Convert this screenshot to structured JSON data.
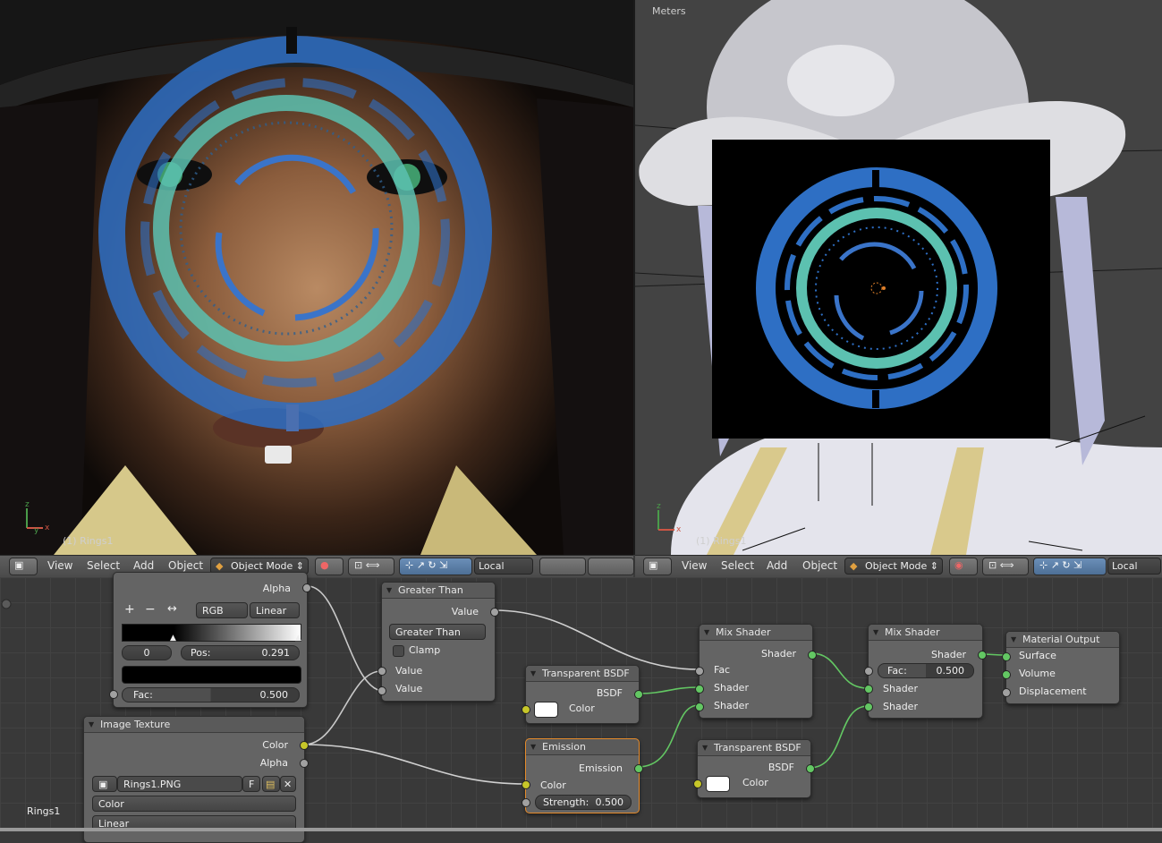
{
  "viewport_left": {
    "object_label": "(1) Rings1"
  },
  "viewport_right": {
    "units_label": "Meters",
    "object_label": "(1) Rings1"
  },
  "header_left": {
    "menus": [
      "View",
      "Select",
      "Add",
      "Object"
    ],
    "mode": "Object Mode",
    "orientation": "Local"
  },
  "header_right": {
    "menus": [
      "View",
      "Select",
      "Add",
      "Object"
    ],
    "mode": "Object Mode",
    "orientation": "Local"
  },
  "nodes": {
    "color_ramp": {
      "alpha_label": "Alpha",
      "color_mode": "RGB",
      "interpolation": "Linear",
      "stop_index": "0",
      "pos_label": "Pos:",
      "pos_value": "0.291",
      "fac_label": "Fac:",
      "fac_value": "0.500"
    },
    "image_texture": {
      "title": "Image Texture",
      "out_color": "Color",
      "out_alpha": "Alpha",
      "image_name": "Rings1.PNG",
      "fake_user": "F",
      "colorspace": "Color",
      "interpolation": "Linear"
    },
    "greater_than": {
      "title": "Greater Than",
      "out_value": "Value",
      "operation": "Greater Than",
      "clamp": "Clamp",
      "in_value1": "Value",
      "in_value2": "Value"
    },
    "transparent_bsdf_1": {
      "title": "Transparent BSDF",
      "out_bsdf": "BSDF",
      "in_color": "Color"
    },
    "emission": {
      "title": "Emission",
      "out_emission": "Emission",
      "in_color": "Color",
      "strength_label": "Strength:",
      "strength_value": "0.500"
    },
    "mix_shader_1": {
      "title": "Mix Shader",
      "out_shader": "Shader",
      "in_fac": "Fac",
      "in_shader1": "Shader",
      "in_shader2": "Shader"
    },
    "transparent_bsdf_2": {
      "title": "Transparent BSDF",
      "out_bsdf": "BSDF",
      "in_color": "Color"
    },
    "mix_shader_2": {
      "title": "Mix Shader",
      "out_shader": "Shader",
      "fac_label": "Fac:",
      "fac_value": "0.500",
      "in_shader1": "Shader",
      "in_shader2": "Shader"
    },
    "material_output": {
      "title": "Material Output",
      "in_surface": "Surface",
      "in_volume": "Volume",
      "in_displacement": "Displacement"
    }
  },
  "material_label": "Rings1",
  "colors": {
    "ring_blue": "#2e6fc4",
    "ring_teal": "#5cc1b0",
    "socket_green": "#63c763",
    "socket_yellow": "#c7c729",
    "selected_outline": "#e58a2a"
  }
}
